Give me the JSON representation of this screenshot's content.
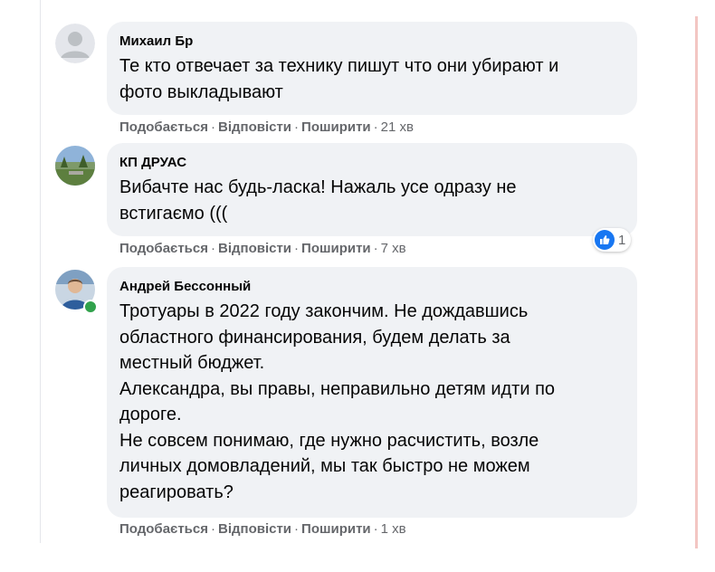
{
  "comments": [
    {
      "author": "Михаил Бр",
      "text": "Те кто отвечает за технику пишут что они убирают и\nфото выкладывают",
      "actions": {
        "like": "Подобається",
        "reply": "Відповісти",
        "share": "Поширити",
        "time": "21 хв"
      },
      "avatar": "default-avatar-icon"
    },
    {
      "author": "КП ДРУАС",
      "text": "Вибачте нас будь-ласка! Нажаль усе одразу не\nвстигаємо (((",
      "actions": {
        "like": "Подобається",
        "reply": "Відповісти",
        "share": "Поширити",
        "time": "7 хв"
      },
      "reaction_count": "1",
      "avatar": "landscape-avatar"
    },
    {
      "author": "Андрей Бессонный",
      "text": "Тротуары в 2022 году закончим. Не дождавшись\nобластного финансирования, будем делать за\nместный бюджет.\nАлександра, вы правы, неправильно детям идти по\nдороге.\nНе совсем понимаю, где нужно расчистить, возле\nличных домовладений, мы так быстро не можем\nреагировать?",
      "actions": {
        "like": "Подобається",
        "reply": "Відповісти",
        "share": "Поширити",
        "time": "1 хв"
      },
      "online": true,
      "avatar": "person-avatar"
    }
  ],
  "separator": "·",
  "colors": {
    "bubble": "#f0f2f5",
    "meta": "#65676b",
    "like": "#1877f2",
    "online": "#31a24c"
  }
}
